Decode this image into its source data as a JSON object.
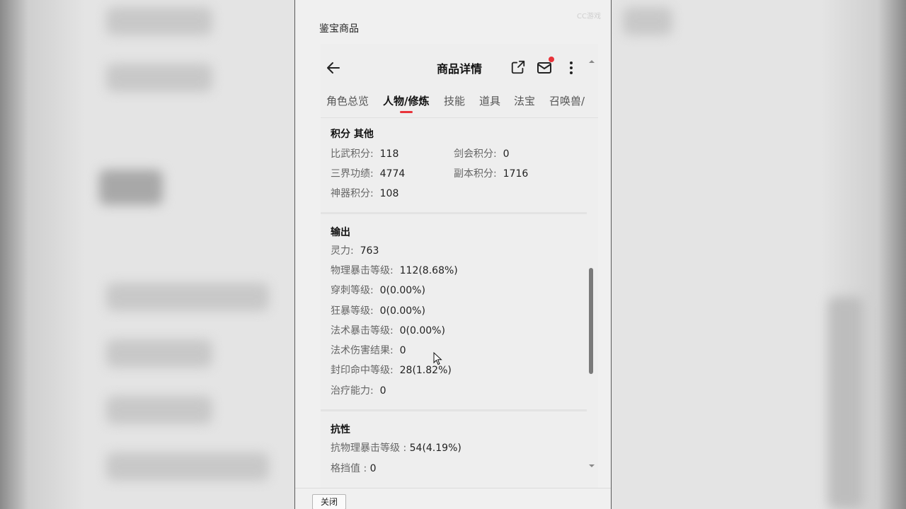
{
  "dialog": {
    "title": "鉴宝商品",
    "watermark": "CC游戏",
    "close_label": "关闭"
  },
  "header": {
    "title": "商品详情",
    "icons": [
      "back-arrow-icon",
      "share-icon",
      "mail-icon",
      "more-icon"
    ]
  },
  "tabs": [
    {
      "label": "角色总览",
      "active": false
    },
    {
      "label": "人物/修炼",
      "active": true
    },
    {
      "label": "技能",
      "active": false
    },
    {
      "label": "道具",
      "active": false
    },
    {
      "label": "法宝",
      "active": false
    },
    {
      "label": "召唤兽/",
      "active": false
    }
  ],
  "sections": {
    "points": {
      "title": "积分 其他",
      "items": [
        {
          "label": "比武积分:",
          "value": "118"
        },
        {
          "label": "剑会积分:",
          "value": "0"
        },
        {
          "label": "三界功绩:",
          "value": "4774"
        },
        {
          "label": "副本积分:",
          "value": "1716"
        },
        {
          "label": "神器积分:",
          "value": "108"
        }
      ]
    },
    "output": {
      "title": "输出",
      "items": [
        {
          "label": "灵力:",
          "value": "763"
        },
        {
          "label": "物理暴击等级:",
          "value": "112(8.68%)"
        },
        {
          "label": "穿刺等级:",
          "value": "0(0.00%)"
        },
        {
          "label": "狂暴等级:",
          "value": "0(0.00%)"
        },
        {
          "label": "法术暴击等级:",
          "value": "0(0.00%)"
        },
        {
          "label": "法术伤害结果:",
          "value": "0"
        },
        {
          "label": "封印命中等级:",
          "value": "28(1.82%)"
        },
        {
          "label": "治疗能力:",
          "value": "0"
        }
      ]
    },
    "resistance": {
      "title": "抗性",
      "items": [
        {
          "label": "抗物理暴击等级 :",
          "value": "54(4.19%)"
        },
        {
          "label": "格挡值 :",
          "value": "0"
        }
      ]
    }
  },
  "colors": {
    "accent": "#e8333a",
    "text_primary": "#222222",
    "text_label": "#666666"
  }
}
